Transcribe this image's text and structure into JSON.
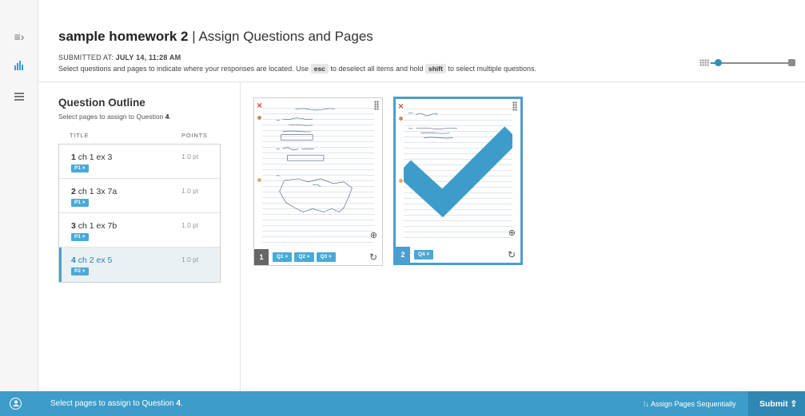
{
  "rail": {
    "icons": [
      "menu-expand-icon",
      "bar-chart-icon",
      "outline-list-icon"
    ],
    "menu_glyph": "≡›"
  },
  "header": {
    "assignment_name": "sample homework 2",
    "separator": "|",
    "page_title": "Assign Questions and Pages",
    "submitted_label": "SUBMITTED AT:",
    "submitted_value": "JULY 14, 11:28 AM",
    "instructions": {
      "part1": "Select questions and pages to indicate where your responses are located. Use",
      "key1": "esc",
      "part2": "to deselect all items and hold",
      "key2": "shift",
      "part3": "to select multiple questions."
    },
    "zoom_level": 0.1
  },
  "outline": {
    "title": "Question Outline",
    "subtitle_prefix": "Select pages to assign to Question",
    "subtitle_question": "4",
    "subtitle_suffix": ".",
    "col_title": "TITLE",
    "col_points": "POINTS",
    "questions": [
      {
        "number": "1",
        "title": "ch 1 ex 3",
        "points": "1.0 pt",
        "tag": "P1 ×",
        "active": false
      },
      {
        "number": "2",
        "title": "ch 1 3x 7a",
        "points": "1.0 pt",
        "tag": "P1 ×",
        "active": false
      },
      {
        "number": "3",
        "title": "ch 1 ex 7b",
        "points": "1.0 pt",
        "tag": "P1 ×",
        "active": false
      },
      {
        "number": "4",
        "title": "ch 2 ex 5",
        "points": "1.0 pt",
        "tag": "P2 ×",
        "active": true
      }
    ]
  },
  "pages": [
    {
      "number": "1",
      "tags": [
        "Q1 ×",
        "Q2 ×",
        "Q3 ×"
      ],
      "selected": false
    },
    {
      "number": "2",
      "tags": [
        "Q4 ×"
      ],
      "selected": true
    }
  ],
  "page_glyphs": {
    "remove": "×",
    "zoom": "⊕",
    "rotate": "↻"
  },
  "footer": {
    "message_prefix": "Select pages to assign to Question",
    "message_question": "4",
    "message_suffix": ".",
    "sequential_label": "⁞↓ Assign Pages Sequentially",
    "submit_label": "Submit ⇪"
  },
  "colors": {
    "accent": "#3d9cc9",
    "tag": "#4aa9d6",
    "active_question_text": "#2f83ad",
    "remove_mark": "#e0504a",
    "check": "#3d9cc9"
  }
}
